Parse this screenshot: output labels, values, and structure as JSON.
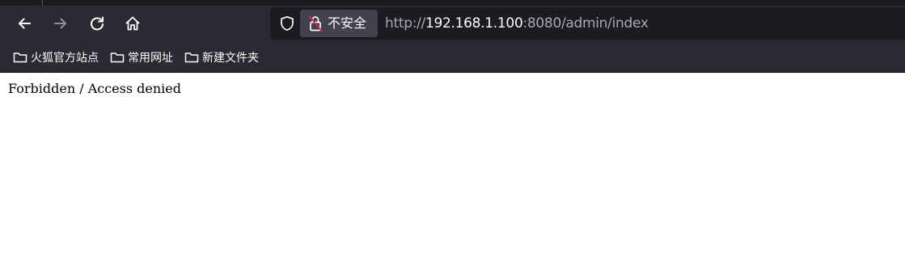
{
  "toolbar": {
    "back_icon": "arrow-left-icon",
    "forward_icon": "arrow-right-icon",
    "reload_icon": "reload-icon",
    "home_icon": "home-icon"
  },
  "urlbar": {
    "tracking_icon": "shield-icon",
    "security_icon": "insecure-lock-icon",
    "security_label": "不安全",
    "url_scheme": "http://",
    "url_host": "192.168.1.100",
    "url_rest": ":8080/admin/index"
  },
  "bookmarks": [
    {
      "label": "火狐官方站点",
      "icon": "folder-icon"
    },
    {
      "label": "常用网址",
      "icon": "folder-icon"
    },
    {
      "label": "新建文件夹",
      "icon": "folder-icon"
    }
  ],
  "page": {
    "message": "Forbidden / Access denied"
  },
  "colors": {
    "chrome_bg": "#2b2a33",
    "urlbar_bg": "#1c1b22",
    "identity_bg": "#42414d",
    "insecure_accent": "#e22850"
  }
}
